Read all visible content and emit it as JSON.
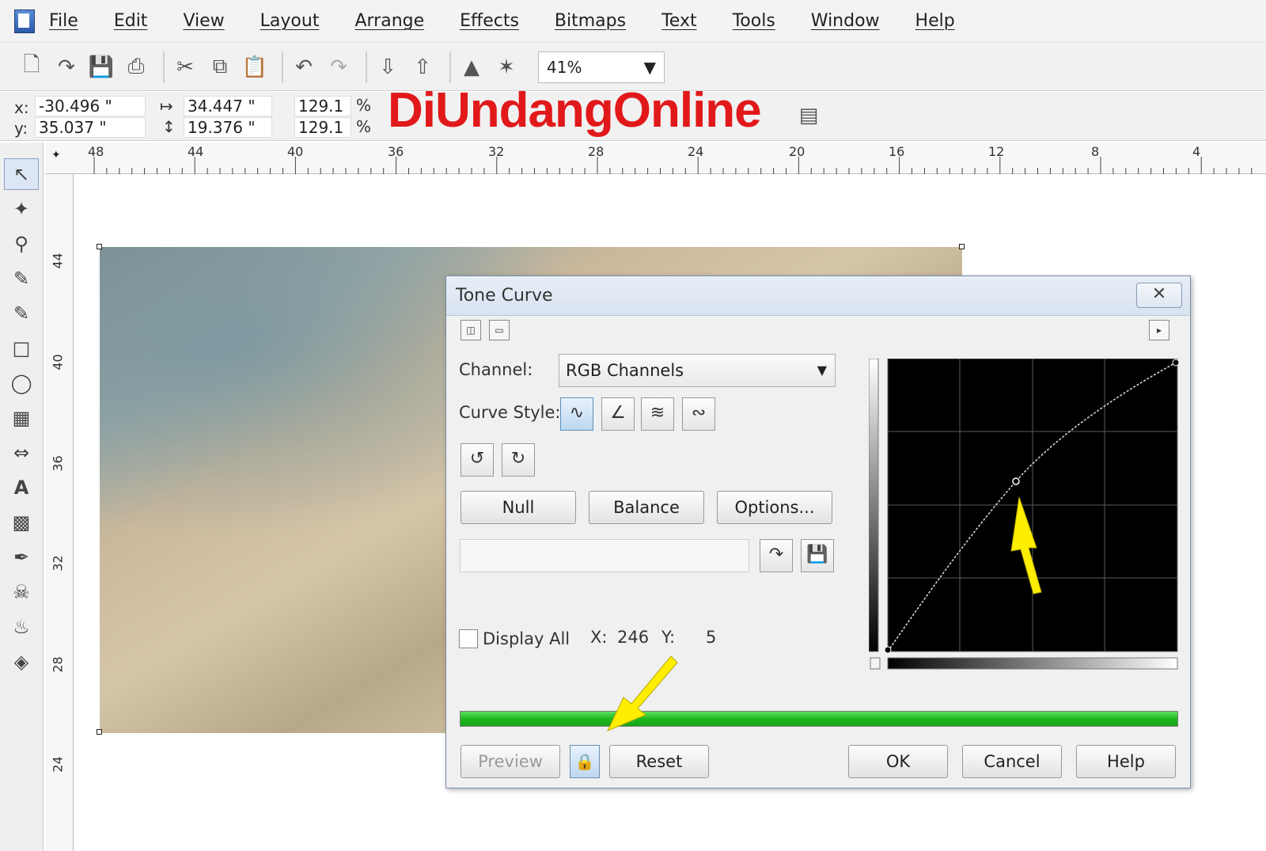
{
  "menu": {
    "items": [
      "File",
      "Edit",
      "View",
      "Layout",
      "Arrange",
      "Effects",
      "Bitmaps",
      "Text",
      "Tools",
      "Window",
      "Help"
    ]
  },
  "toolbar": {
    "zoom": "41%"
  },
  "property_bar": {
    "x_label": "x:",
    "x_value": "-30.496 \"",
    "y_label": "y:",
    "y_value": "35.037 \"",
    "width_value": "34.447 \"",
    "height_value": "19.376 \"",
    "scale_x": "129.1",
    "scale_y": "129.1",
    "percent_x": "%",
    "percent_y": "%"
  },
  "watermark": "DiUndangOnline",
  "ruler": {
    "horizontal": [
      "48",
      "44",
      "40",
      "36",
      "32",
      "28",
      "24",
      "20",
      "16",
      "12",
      "8",
      "4"
    ],
    "vertical": [
      "44",
      "40",
      "36",
      "32",
      "28",
      "24"
    ]
  },
  "dialog": {
    "title": "Tone Curve",
    "close_icon": "close-icon",
    "channel_label": "Channel:",
    "channel_value": "RGB Channels",
    "curve_style_label": "Curve Style:",
    "buttons": {
      "null": "Null",
      "balance": "Balance",
      "options": "Options...",
      "preview": "Preview",
      "reset": "Reset",
      "ok": "OK",
      "cancel": "Cancel",
      "help": "Help"
    },
    "display_all_label": "Display All",
    "x_label": "X:",
    "x_value": "246",
    "y_label": "Y:",
    "y_value": "5",
    "progress_color": "#1db81d"
  },
  "colors": {
    "accent": "#e1191b",
    "arrow": "#ffee00"
  }
}
